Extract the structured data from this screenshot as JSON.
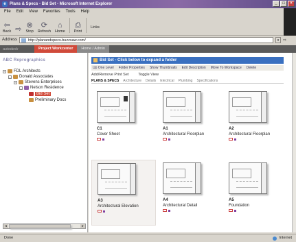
{
  "window": {
    "title": "Plans & Specs - Bid Set - Microsoft Internet Explorer"
  },
  "menu": [
    "File",
    "Edit",
    "View",
    "Favorites",
    "Tools",
    "Help"
  ],
  "toolbar": {
    "back": "Back",
    "forward": "",
    "stop": "Stop",
    "refresh": "Refresh",
    "home": "Home",
    "print": "Print",
    "links": "Links"
  },
  "address": {
    "label": "Address",
    "url": "http://planandspecs.buzzsaw.com/"
  },
  "appnav": {
    "brand": "autodesk",
    "tabs": [
      "Project Workcenter",
      "Home / Admin"
    ]
  },
  "sidebar": {
    "heading": "ABC Reprographics",
    "tree": [
      {
        "label": "FDL Architects"
      },
      {
        "label": "Donald Associates"
      },
      {
        "label": "Stevens Enterprises"
      },
      {
        "label": "Nelson Residence"
      },
      {
        "label": "Bid Set"
      },
      {
        "label": "Preliminary Docs"
      }
    ]
  },
  "content": {
    "title": "Bid Set - Click below to expand a folder",
    "actions": [
      "Up One Level",
      "Folder Properties",
      "Show Thumbnails",
      "Edit Description",
      "Move To Workspace",
      "Delete"
    ],
    "subactions": [
      "Add/Remove Print Set",
      "Toggle View"
    ],
    "subtabs": [
      "PLANS & SPECS",
      "Architecture",
      "Details",
      "Electrical",
      "Plumbing",
      "Specifications"
    ],
    "cards": [
      {
        "code": "C1",
        "name": "Cover Sheet"
      },
      {
        "code": "A1",
        "name": "Architectural Floorplan"
      },
      {
        "code": "A2",
        "name": "Architectural Floorplan"
      },
      {
        "code": "A3",
        "name": "Architectural Elevation"
      },
      {
        "code": "A4",
        "name": "Architectural Detail"
      },
      {
        "code": "A5",
        "name": "Foundation"
      }
    ]
  },
  "status": {
    "left": "Done",
    "right": "Internet"
  },
  "colors": {
    "accent": "#d04a3a",
    "title_blue": "#3a70c0",
    "title_bar": "#5a4a8e"
  }
}
